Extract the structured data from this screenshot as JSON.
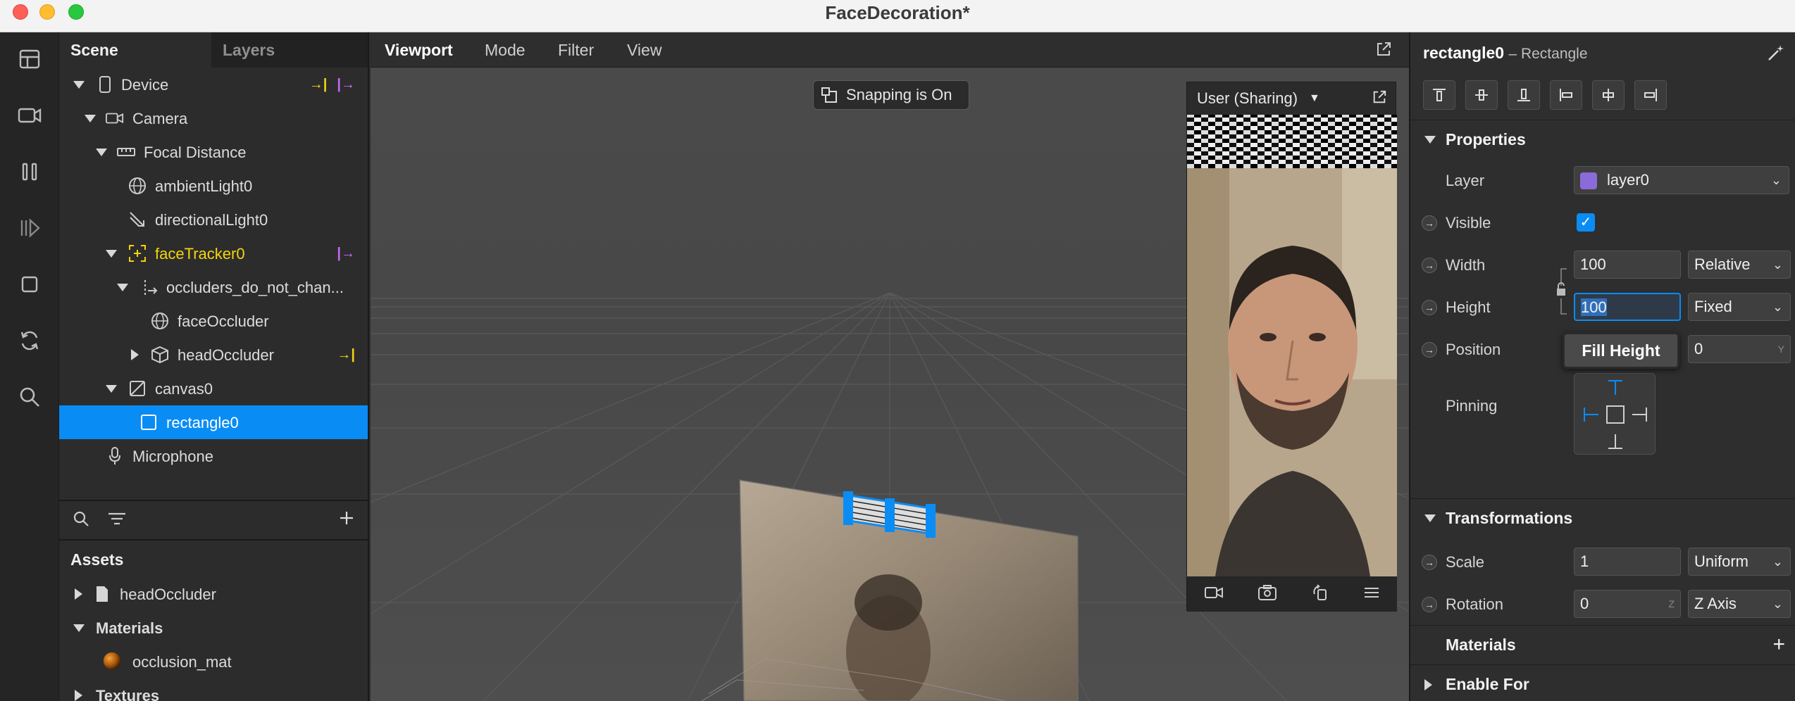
{
  "window": {
    "title": "FaceDecoration*"
  },
  "scene_panel": {
    "tabs": [
      "Scene",
      "Layers"
    ],
    "tree": [
      {
        "label": "Device",
        "icon": "device-icon"
      },
      {
        "label": "Camera",
        "icon": "camera-icon"
      },
      {
        "label": "Focal Distance",
        "icon": "ruler-icon"
      },
      {
        "label": "ambientLight0",
        "icon": "globe-icon"
      },
      {
        "label": "directionalLight0",
        "icon": "directional-light-icon"
      },
      {
        "label": "faceTracker0",
        "icon": "face-tracker-icon"
      },
      {
        "label": "occluders_do_not_chan...",
        "icon": "null-object-icon"
      },
      {
        "label": "faceOccluder",
        "icon": "globe-icon"
      },
      {
        "label": "headOccluder",
        "icon": "cube-icon"
      },
      {
        "label": "canvas0",
        "icon": "canvas-icon"
      },
      {
        "label": "rectangle0",
        "icon": "rectangle-icon"
      },
      {
        "label": "Microphone",
        "icon": "microphone-icon"
      }
    ]
  },
  "assets": {
    "title": "Assets",
    "items": [
      {
        "label": "headOccluder",
        "icon": "file-icon"
      },
      {
        "label": "Materials"
      },
      {
        "label": "occlusion_mat",
        "icon": "material-sphere-icon"
      },
      {
        "label": "Textures"
      }
    ]
  },
  "viewport": {
    "menu": [
      "Viewport",
      "Mode",
      "Filter",
      "View"
    ],
    "snapping_label": "Snapping is On",
    "preview": {
      "device_label": "User (Sharing)"
    }
  },
  "inspector": {
    "object_name": "rectangle0",
    "object_type": "– Rectangle",
    "sections": {
      "properties": "Properties",
      "transformations": "Transformations",
      "materials": "Materials",
      "enable_for": "Enable For"
    },
    "props": {
      "layer_label": "Layer",
      "layer_value": "layer0",
      "visible_label": "Visible",
      "width_label": "Width",
      "width_value": "100",
      "width_mode": "Relative",
      "height_label": "Height",
      "height_value": "100",
      "height_mode": "Fixed",
      "position_label": "Position",
      "position_y": "0",
      "position_y_axis": "Y",
      "pinning_label": "Pinning",
      "fill_height_tooltip": "Fill Height",
      "scale_label": "Scale",
      "scale_value": "1",
      "scale_mode": "Uniform",
      "rotation_label": "Rotation",
      "rotation_value": "0",
      "rotation_axis_hint": "Z",
      "rotation_axis": "Z Axis"
    }
  },
  "colors": {
    "accent": "#0a8cf5",
    "tracker_yellow": "#f5d40e",
    "link_purple": "#c86af3",
    "layer_swatch": "#8b6bd9"
  }
}
